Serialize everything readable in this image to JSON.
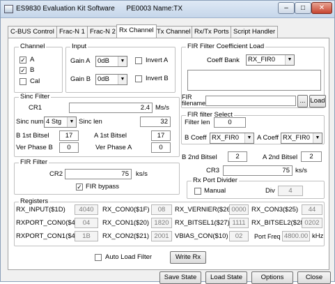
{
  "window": {
    "title": "ES9830 Evaluation Kit Software      PE0003 Name:TX",
    "min": "–",
    "max": "□",
    "close": "✕"
  },
  "tabs": [
    "C-BUS Control",
    "Frac-N 1",
    "Frac-N 2",
    "Rx Channel",
    "Tx Channel",
    "Rx/Tx Ports",
    "Script Handler"
  ],
  "channel": {
    "title": "Channel",
    "a": "A",
    "b": "B",
    "cal": "Cal",
    "a_checked": true,
    "b_checked": true,
    "cal_checked": false
  },
  "input": {
    "title": "Input",
    "gain_a_label": "Gain A",
    "gain_a_value": "0dB",
    "gain_b_label": "Gain B",
    "gain_b_value": "0dB",
    "invert_a": "Invert A",
    "invert_b": "Invert B"
  },
  "fir_coeff": {
    "title": "FIR Filter Coefficient Load",
    "bank_label": "Coeff Bank",
    "bank_value": "RX_FIR0",
    "filename_label": "FIR\nfilename",
    "filename_value": "",
    "browse": "...",
    "load": "Load"
  },
  "sinc": {
    "title": "Sinc Filter",
    "cr1_label": "CR1",
    "cr1_value": "2.4",
    "cr1_unit": "Ms/s",
    "num_label": "Sinc num",
    "num_value": "4 Stg",
    "len_label": "Sinc len",
    "len_value": "32",
    "b1st_label": "B 1st Bitsel",
    "b1st_value": "17",
    "a1st_label": "A 1st Bitsel",
    "a1st_value": "17",
    "verb_label": "Ver Phase B",
    "verb_value": "0",
    "vera_label": "Ver Phase A",
    "vera_value": "0"
  },
  "fir_select": {
    "title": "FIR filter Select",
    "len_label": "Filter len",
    "len_value": "0",
    "bcoeff_label": "B Coeff",
    "bcoeff_value": "RX_FIR0",
    "acoeff_label": "A Coeff",
    "acoeff_value": "RX_FIR0"
  },
  "second_bitsel": {
    "b_label": "B 2nd Bitsel",
    "b_value": "2",
    "a_label": "A 2nd Bitsel",
    "a_value": "2",
    "cr3_label": "CR3",
    "cr3_value": "75",
    "cr3_unit": "ks/s"
  },
  "fir_filter": {
    "title": "FIR Filter",
    "cr2_label": "CR2",
    "cr2_value": "75",
    "cr2_unit": "ks/s",
    "bypass_label": "FIR bypass",
    "bypass_checked": true
  },
  "port_divider": {
    "title": "Rx Port Divider",
    "manual_label": "Manual",
    "div_label": "Div",
    "div_value": "4"
  },
  "registers": {
    "title": "Registers",
    "rows": [
      [
        "RX_INPUT($1D)",
        "4040",
        "RX_CON0($1F)",
        "08",
        "RX_VERNIER($26)",
        "0000",
        "RX_CON3($25)",
        "44"
      ],
      [
        "RXPORT_CON0($40)",
        "04",
        "RX_CON1($20)",
        "1820",
        "RX_BITSEL1($27)",
        "1111",
        "RX_BITSEL2($28)",
        "0202"
      ],
      [
        "RXPORT_CON1($41)",
        "1B",
        "RX_CON2($21)",
        "2001",
        "VBIAS_CON($10)",
        "02",
        "Port Freq",
        "4800.00"
      ]
    ],
    "port_freq_unit": "kHz"
  },
  "auto_load": {
    "label": "Auto Load Filter",
    "checked": false
  },
  "write_rx": "Write Rx",
  "footer": {
    "save": "Save State",
    "load": "Load State",
    "options": "Options",
    "close": "Close"
  }
}
